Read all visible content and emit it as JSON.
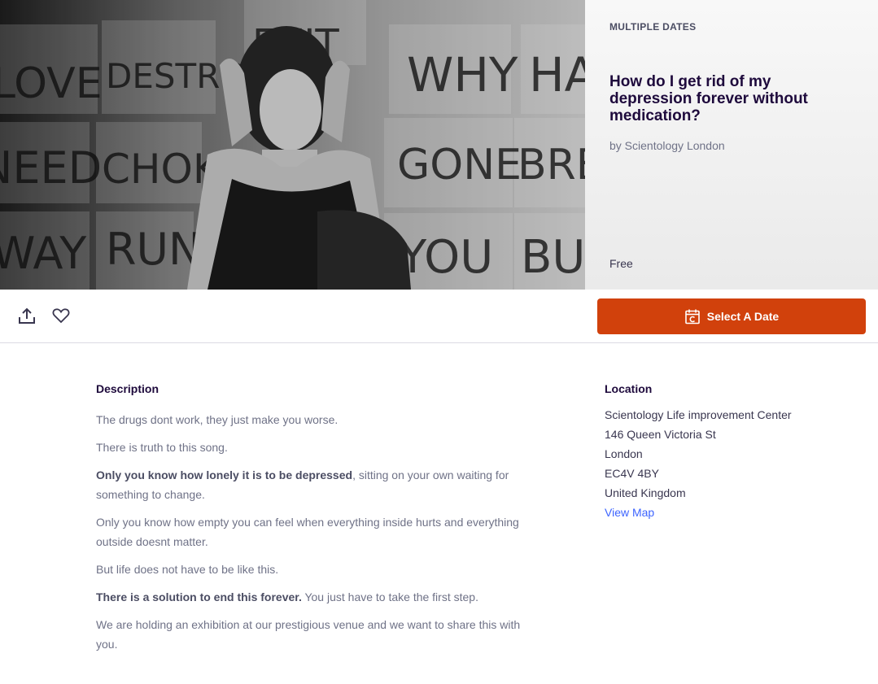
{
  "hero": {
    "image_signs": [
      "LOVE",
      "DESTROY",
      "EXIT",
      "WHY",
      "HATE",
      "NEED",
      "CHOKE",
      "GONE",
      "BREAK",
      "WAY",
      "RUN",
      "YOU",
      "BURN"
    ],
    "multiple_dates": "MULTIPLE DATES",
    "title": "How do I get rid of my depression forever without medication?",
    "organizer": "by Scientology London",
    "price": "Free"
  },
  "actions": {
    "share_icon": "share-icon",
    "like_icon": "heart-icon",
    "select_date_label": "Select A Date",
    "select_date_icon": "calendar-icon",
    "accent_color": "#d1410c"
  },
  "description": {
    "heading": "Description",
    "p1": "The drugs dont work, they just make you worse.",
    "p2": "There is truth to this song.",
    "p3_bold": "Only you know how lonely it is to be depressed",
    "p3_rest": ", sitting on your own waiting for something to change.",
    "p4": "Only you know how empty you can feel when everything inside hurts and everything outside doesnt matter.",
    "p5": "But life does not have to be like this.",
    "p6_bold": "There is a solution to end this forever.",
    "p6_rest": " You just have to take the first step.",
    "p7": "We are holding an exhibition at our prestigious venue and we want to share this with you."
  },
  "location": {
    "heading": "Location",
    "venue": "Scientology Life improvement Center",
    "street": "146 Queen Victoria St",
    "city": "London",
    "postcode": "EC4V 4BY",
    "country": "United Kingdom",
    "view_map": "View Map",
    "link_color": "#3d64ff"
  }
}
